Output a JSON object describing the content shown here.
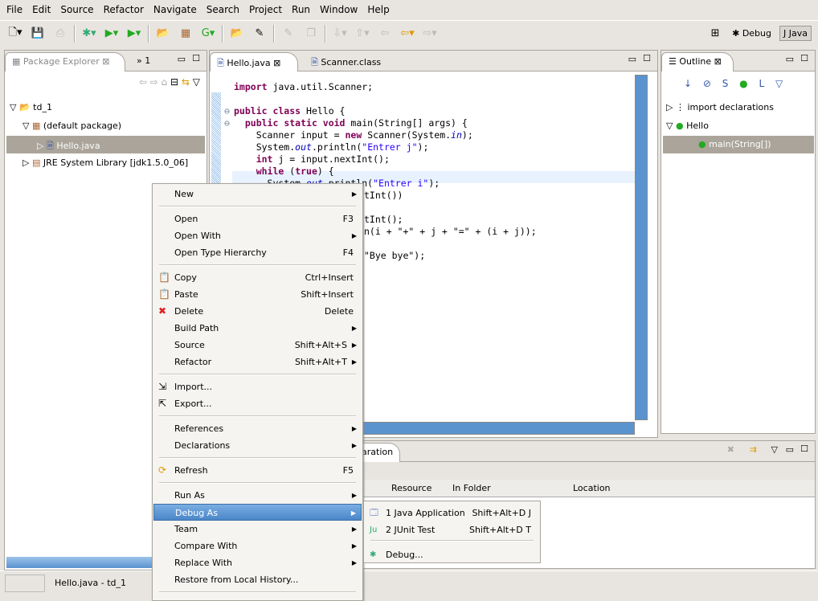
{
  "menubar": [
    "File",
    "Edit",
    "Source",
    "Refactor",
    "Navigate",
    "Search",
    "Project",
    "Run",
    "Window",
    "Help"
  ],
  "perspectives": {
    "debug": "Debug",
    "java": "Java"
  },
  "package_explorer": {
    "title": "Package Explorer",
    "overflow": "1",
    "project": "td_1",
    "package": "(default package)",
    "file": "Hello.java",
    "library": "JRE System Library [jdk1.5.0_06]"
  },
  "editor": {
    "tabs": [
      "Hello.java",
      "Scanner.class"
    ],
    "visible_fragments": [
      "tInt())",
      "tInt();",
      "n(i + \"+\" + j + \"=\" + (i + j));",
      "\"Bye bye\");"
    ]
  },
  "outline": {
    "title": "Outline",
    "items": [
      "import declarations",
      "Hello",
      "main(String[])"
    ]
  },
  "bottom_panel": {
    "tab_fragment": "aration",
    "columns": [
      "Resource",
      "In Folder",
      "Location"
    ]
  },
  "status": {
    "text": "Hello.java - td_1"
  },
  "context_menu": [
    {
      "label": "New",
      "sub": true
    },
    {
      "sep": true
    },
    {
      "label": "Open",
      "acc": "F3"
    },
    {
      "label": "Open With",
      "sub": true
    },
    {
      "label": "Open Type Hierarchy",
      "acc": "F4"
    },
    {
      "sep": true
    },
    {
      "label": "Copy",
      "acc": "Ctrl+Insert",
      "icon": "copy-icon"
    },
    {
      "label": "Paste",
      "acc": "Shift+Insert",
      "icon": "paste-icon"
    },
    {
      "label": "Delete",
      "acc": "Delete",
      "icon": "delete-icon"
    },
    {
      "label": "Build Path",
      "sub": true
    },
    {
      "label": "Source",
      "acc": "Shift+Alt+S",
      "sub": true
    },
    {
      "label": "Refactor",
      "acc": "Shift+Alt+T",
      "sub": true
    },
    {
      "sep": true
    },
    {
      "label": "Import...",
      "icon": "import-icon"
    },
    {
      "label": "Export...",
      "icon": "export-icon"
    },
    {
      "sep": true
    },
    {
      "label": "References",
      "sub": true
    },
    {
      "label": "Declarations",
      "sub": true
    },
    {
      "sep": true
    },
    {
      "label": "Refresh",
      "acc": "F5",
      "icon": "refresh-icon"
    },
    {
      "sep": true
    },
    {
      "label": "Run As",
      "sub": true
    },
    {
      "label": "Debug As",
      "sub": true,
      "highlighted": true
    },
    {
      "label": "Team",
      "sub": true
    },
    {
      "label": "Compare With",
      "sub": true
    },
    {
      "label": "Replace With",
      "sub": true
    },
    {
      "label": "Restore from Local History..."
    },
    {
      "sep": true
    }
  ],
  "debug_submenu": [
    {
      "label": "1 Java Application",
      "acc": "Shift+Alt+D J"
    },
    {
      "label": "2 JUnit Test",
      "acc": "Shift+Alt+D T"
    },
    {
      "label": "Debug..."
    }
  ],
  "colors": {
    "selection": "#4a86c8",
    "keyword": "#7f0055",
    "string": "#2a00ff",
    "tree_selection": "#aaa49a"
  }
}
